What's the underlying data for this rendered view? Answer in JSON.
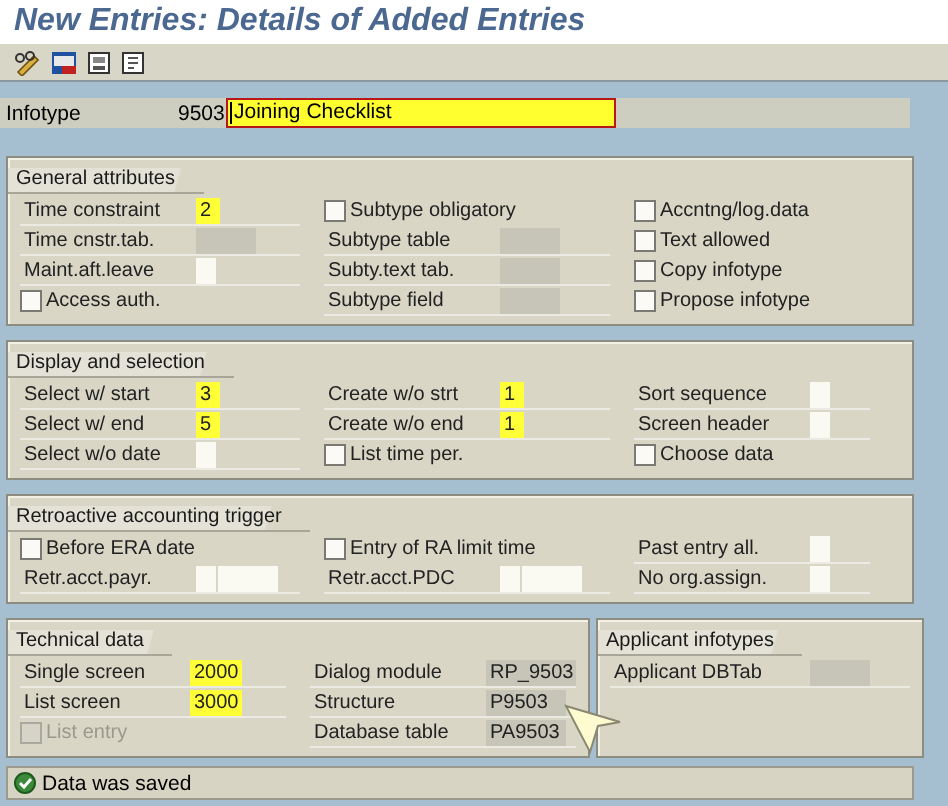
{
  "title": "New Entries: Details of Added Entries",
  "infotype": {
    "label": "Infotype",
    "number": "9503",
    "name": "Joining Checklist"
  },
  "sections": [
    [
      {
        "title": "General attributes",
        "rows": [
          [
            {
              "kind": "field",
              "label": "Time constraint",
              "value": "2",
              "editable": true
            },
            {
              "kind": "check",
              "label": "Subtype obligatory",
              "checked": false,
              "disabled": false
            },
            {
              "kind": "check",
              "label": "Accntng/log.data",
              "checked": false,
              "disabled": false
            }
          ],
          [
            {
              "kind": "field",
              "label": "Time cnstr.tab.",
              "editable": false
            },
            {
              "kind": "field",
              "label": "Subtype table",
              "editable": false
            },
            {
              "kind": "check",
              "label": "Text allowed",
              "checked": false,
              "disabled": false
            }
          ],
          [
            {
              "kind": "field",
              "label": "Maint.aft.leave",
              "editable": true
            },
            {
              "kind": "field",
              "label": "Subty.text tab.",
              "editable": false
            },
            {
              "kind": "check",
              "label": "Copy infotype",
              "checked": false,
              "disabled": false
            }
          ],
          [
            {
              "kind": "check",
              "label": "Access auth.",
              "checked": false,
              "disabled": false
            },
            {
              "kind": "field",
              "label": "Subtype field",
              "editable": false
            },
            {
              "kind": "check",
              "label": "Propose infotype",
              "checked": false,
              "disabled": false
            }
          ]
        ]
      }
    ],
    [
      {
        "title": "Display and selection",
        "rows": [
          [
            {
              "kind": "field",
              "label": "Select w/ start",
              "value": "3",
              "editable": true
            },
            {
              "kind": "field",
              "label": "Create w/o strt",
              "value": "1",
              "editable": true
            },
            {
              "kind": "field",
              "label": "Sort sequence",
              "editable": true
            }
          ],
          [
            {
              "kind": "field",
              "label": "Select w/ end",
              "value": "5",
              "editable": true
            },
            {
              "kind": "field",
              "label": "Create w/o end",
              "value": "1",
              "editable": true
            },
            {
              "kind": "field",
              "label": "Screen header",
              "editable": true
            }
          ],
          [
            {
              "kind": "field",
              "label": "Select w/o date",
              "editable": true
            },
            {
              "kind": "check",
              "label": "List time per.",
              "checked": false,
              "disabled": false
            },
            {
              "kind": "check",
              "label": "Choose data",
              "checked": false,
              "disabled": false
            }
          ]
        ]
      }
    ],
    [
      {
        "title": "Retroactive accounting trigger",
        "rows": [
          [
            {
              "kind": "check",
              "label": "Before ERA date",
              "checked": false,
              "disabled": false
            },
            {
              "kind": "check",
              "label": "Entry of RA limit time",
              "checked": false,
              "disabled": false
            },
            {
              "kind": "field",
              "label": "Past entry all.",
              "editable": true
            }
          ],
          [
            {
              "kind": "double_field",
              "label": "Retr.acct.payr.",
              "editable": true
            },
            {
              "kind": "double_field",
              "label": "Retr.acct.PDC",
              "editable": true
            },
            {
              "kind": "field",
              "label": "No org.assign.",
              "editable": true
            }
          ]
        ]
      }
    ],
    [
      {
        "title": "Technical data",
        "rows": [
          [
            {
              "kind": "field",
              "label": "Single screen",
              "value": "2000",
              "editable": true
            },
            {
              "kind": "field",
              "label": "Dialog module",
              "value": "RP_9503",
              "editable": false
            }
          ],
          [
            {
              "kind": "field",
              "label": "List screen",
              "value": "3000",
              "editable": true
            },
            {
              "kind": "field",
              "label": "Structure",
              "value": "P9503",
              "editable": false
            }
          ],
          [
            {
              "kind": "check",
              "label": "List entry",
              "checked": false,
              "disabled": true
            },
            {
              "kind": "field",
              "label": "Database table",
              "value": "PA9503",
              "editable": false
            }
          ]
        ]
      },
      {
        "title": "Applicant infotypes",
        "rows": [
          [
            {
              "kind": "field",
              "label": "Applicant DBTab",
              "editable": false
            }
          ]
        ]
      }
    ]
  ],
  "status": "Data was saved"
}
